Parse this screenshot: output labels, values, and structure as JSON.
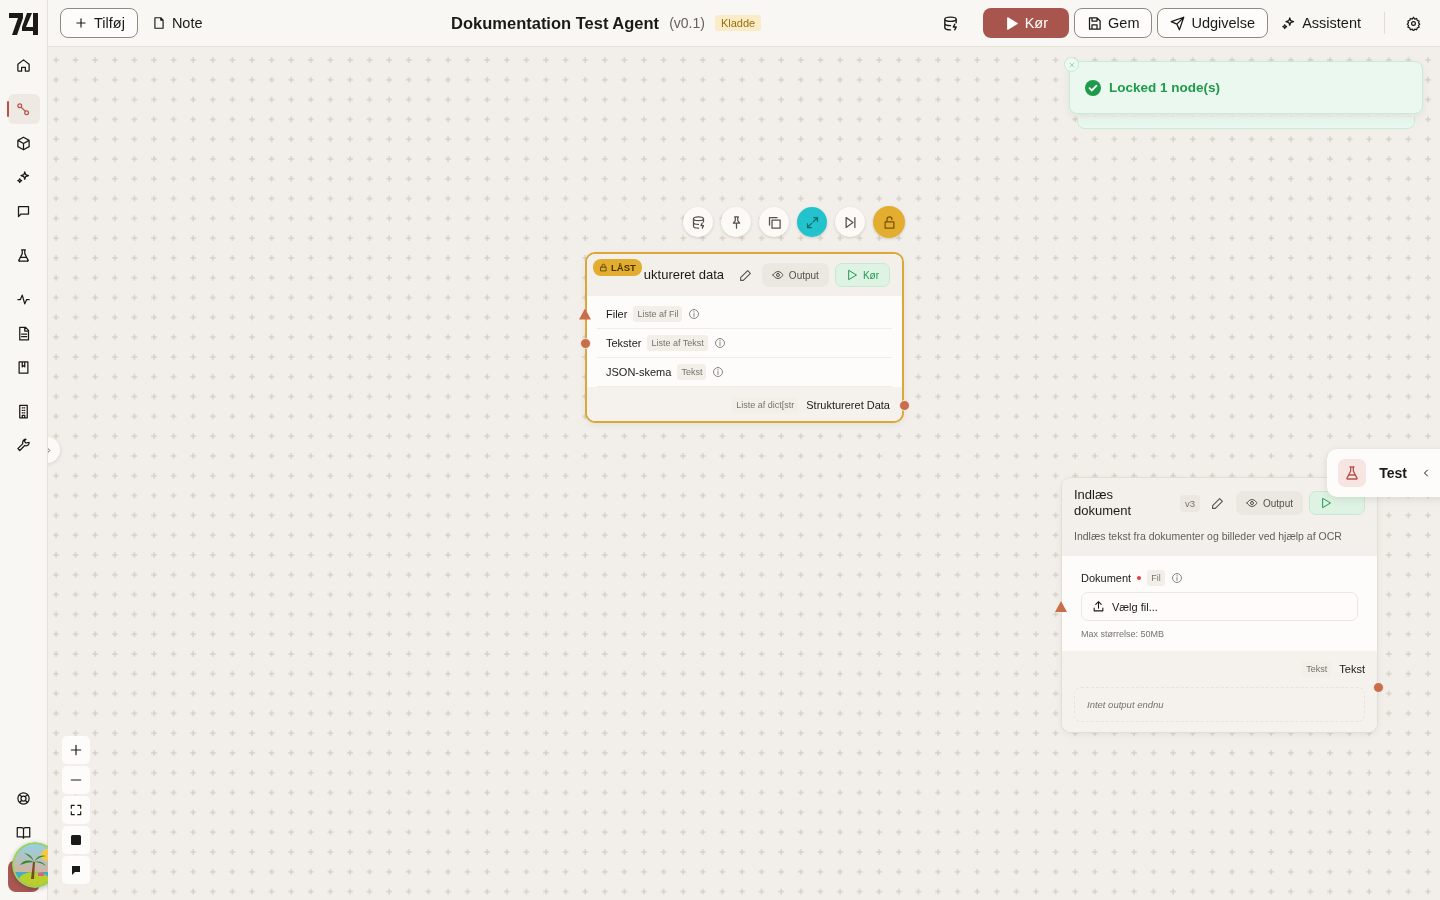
{
  "header": {
    "add_button": "Tilføj",
    "note_button": "Note",
    "title": "Dokumentation Test Agent",
    "version": "(v0.1)",
    "status_badge": "Kladde",
    "actions": [
      {
        "kind": "data"
      },
      {
        "kind": "run",
        "label": "Kør"
      },
      {
        "kind": "save",
        "label": "Gem"
      },
      {
        "kind": "publish",
        "label": "Udgivelse"
      },
      {
        "kind": "assistant",
        "label": "Assistent"
      },
      {
        "kind": "settings"
      }
    ]
  },
  "sidebar": {
    "groups": [
      [
        {
          "kind": "home",
          "selected": false
        }
      ],
      [
        {
          "kind": "workflows",
          "selected": true
        },
        {
          "kind": "components",
          "selected": false
        },
        {
          "kind": "agents",
          "selected": false
        },
        {
          "kind": "chat",
          "selected": false
        }
      ],
      [
        {
          "kind": "tests",
          "selected": false
        }
      ],
      [
        {
          "kind": "activity",
          "selected": false
        },
        {
          "kind": "documents",
          "selected": false
        },
        {
          "kind": "library",
          "selected": false
        }
      ],
      [
        {
          "kind": "organization",
          "selected": false
        },
        {
          "kind": "tools",
          "selected": false
        }
      ]
    ],
    "bottom": [
      {
        "kind": "help"
      },
      {
        "kind": "docs"
      }
    ]
  },
  "toast": {
    "kind": "success",
    "message": "Locked 1 node(s)"
  },
  "node_toolbar": [
    {
      "kind": "data"
    },
    {
      "kind": "pin"
    },
    {
      "kind": "duplicate"
    },
    {
      "kind": "expand"
    },
    {
      "kind": "skip"
    },
    {
      "kind": "lock"
    }
  ],
  "nodes": [
    {
      "selected": true,
      "locked": true,
      "lock_badge": "LÅST",
      "title": "uktureret data",
      "output_button": "Output",
      "run_button": "Kør",
      "inputs": [
        {
          "name": "Filer",
          "type": "Liste af Fil",
          "kind": "triangle"
        },
        {
          "name": "Tekster",
          "type": "Liste af Tekst",
          "kind": "dot"
        },
        {
          "name": "JSON-skema",
          "type": "Tekst",
          "kind": "plain"
        }
      ],
      "output": {
        "type": "Liste af dict[str",
        "name": "Struktureret Data"
      }
    },
    {
      "selected": false,
      "title": "Indlæs dokument",
      "version": "v3",
      "output_button": "Output",
      "description": "Indlæs tekst fra dokumenter og billeder ved hjælp af OCR",
      "inputs": [
        {
          "name": "Dokument",
          "required": true,
          "type": "Fil",
          "kind": "triangle",
          "file_button": "Vælg fil...",
          "hint": "Max størrelse: 50MB"
        }
      ],
      "output": {
        "type": "Tekst",
        "name": "Tekst",
        "placeholder": "Intet output endnu"
      }
    }
  ],
  "test_panel": {
    "label": "Test"
  },
  "zoom_controls": [
    {
      "kind": "zoom-in"
    },
    {
      "kind": "zoom-out"
    },
    {
      "kind": "fit"
    },
    {
      "kind": "square"
    },
    {
      "kind": "bubble"
    }
  ]
}
